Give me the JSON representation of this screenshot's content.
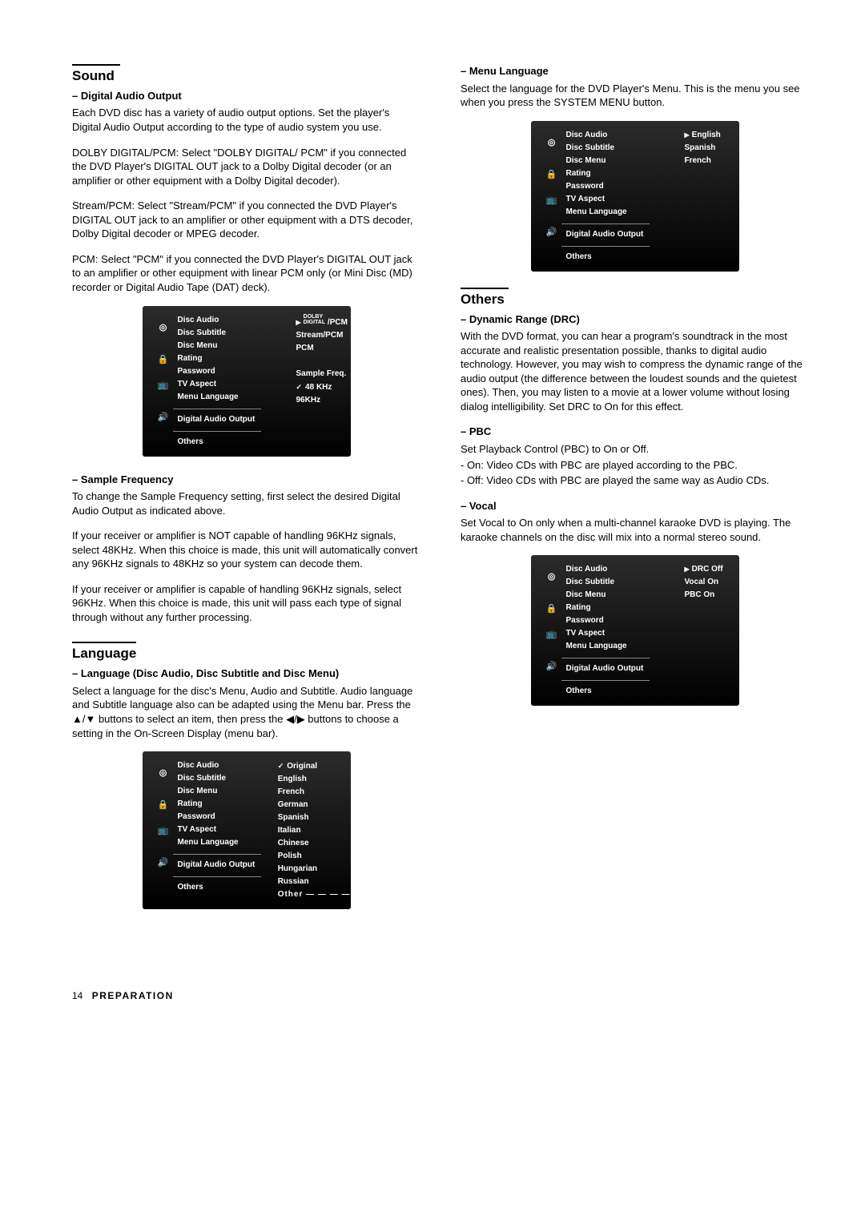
{
  "left": {
    "sound": {
      "rule": true,
      "title": "Sound",
      "sections": [
        {
          "sub": "Digital Audio Output",
          "paras": [
            "Each DVD disc has a variety of audio output options. Set the player's Digital Audio Output according to the type of audio system you use.",
            "DOLBY DIGITAL/PCM: Select \"DOLBY DIGITAL/ PCM\" if you connected the DVD Player's DIGITAL OUT jack to a Dolby Digital decoder (or an amplifier or other equipment with a Dolby Digital decoder).",
            "Stream/PCM: Select \"Stream/PCM\" if you connected the DVD Player's DIGITAL OUT jack to an amplifier or other equipment with a DTS decoder, Dolby Digital decoder or MPEG decoder.",
            "PCM: Select \"PCM\" if you connected the DVD Player's DIGITAL OUT jack to an amplifier or other equipment with linear PCM only (or Mini Disc (MD) recorder or Digital Audio Tape (DAT) deck)."
          ]
        },
        {
          "sub": "Sample Frequency",
          "paras": [
            "To change the Sample Frequency setting, first select the desired Digital Audio Output as indicated above.",
            "If your receiver or amplifier is NOT capable of handling 96KHz signals, select 48KHz. When this choice is made, this unit will automatically convert any 96KHz signals to 48KHz so your system can decode them.",
            "If your receiver or amplifier is capable of handling 96KHz signals, select 96KHz. When this choice is made, this unit will pass each type of signal through without any further processing."
          ]
        }
      ]
    },
    "language": {
      "rule": true,
      "title": "Language",
      "sections": [
        {
          "sub": "Language (Disc Audio, Disc Subtitle and Disc Menu)",
          "paras": [
            "Select a language for the disc's Menu, Audio and Subtitle. Audio language and Subtitle language also can be adapted using the Menu bar. Press the ▲/▼ buttons to select an item, then press the ◀/▶ buttons to choose a setting in the On-Screen Display (menu bar)."
          ]
        }
      ]
    }
  },
  "right": {
    "menulang": {
      "sub": "Menu Language",
      "paras": [
        "Select the language for the DVD Player's Menu. This is the menu you see when you press the SYSTEM MENU button."
      ]
    },
    "others": {
      "rule": true,
      "title": "Others",
      "sections": [
        {
          "sub": "Dynamic Range (DRC)",
          "paras": [
            "With the DVD format, you can hear a program's soundtrack in the most accurate and realistic presentation possible, thanks to digital audio technology. However, you may wish to compress the dynamic range of the audio output (the difference between the loudest sounds and the quietest ones). Then, you may listen to a movie at a lower volume without losing dialog intelligibility. Set DRC to On for this effect."
          ]
        },
        {
          "sub": "PBC",
          "paras": [
            "Set Playback Control (PBC) to On or Off.",
            "- On: Video CDs with PBC are played according to the PBC.",
            "- Off: Video CDs with PBC are played the same way as Audio CDs."
          ]
        },
        {
          "sub": "Vocal",
          "paras": [
            "Set Vocal to On only when a multi-channel karaoke DVD is playing. The karaoke channels on the disc will mix into a normal stereo sound."
          ]
        }
      ]
    }
  },
  "menus": {
    "m1": {
      "left": [
        "Disc Audio",
        "Disc Subtitle",
        "Disc Menu",
        "Rating",
        "Password",
        "TV Aspect",
        "Menu Language",
        "Digital Audio Output",
        "Others"
      ],
      "right_lines": [
        {
          "pre": "tri",
          "html": "<span class='tiny'>DOLBY<br>DIGITAL</span> /PCM"
        },
        {
          "t": "Stream/PCM"
        },
        {
          "t": "PCM"
        },
        {
          "t": ""
        },
        {
          "t": "Sample Freq."
        },
        {
          "pre": "check",
          "t": "48 KHz"
        },
        {
          "t": "96KHz"
        }
      ]
    },
    "m2": {
      "left": [
        "Disc Audio",
        "Disc Subtitle",
        "Disc Menu",
        "Rating",
        "Password",
        "TV Aspect",
        "Menu Language",
        "Digital Audio Output",
        "Others"
      ],
      "right_lines": [
        {
          "pre": "check",
          "t": "Original"
        },
        {
          "t": "English"
        },
        {
          "t": "French"
        },
        {
          "t": "German"
        },
        {
          "t": "Spanish"
        },
        {
          "t": "Italian"
        },
        {
          "t": "Chinese"
        },
        {
          "t": "Polish"
        },
        {
          "t": "Hungarian"
        },
        {
          "t": "Russian"
        },
        {
          "t": "Other  — — — —"
        }
      ]
    },
    "m3": {
      "left": [
        "Disc Audio",
        "Disc Subtitle",
        "Disc Menu",
        "Rating",
        "Password",
        "TV Aspect",
        "Menu Language",
        "Digital Audio Output",
        "Others"
      ],
      "right_lines": [
        {
          "pre": "tri",
          "t": "English"
        },
        {
          "t": "Spanish"
        },
        {
          "t": "French"
        }
      ]
    },
    "m4": {
      "left": [
        "Disc Audio",
        "Disc Subtitle",
        "Disc Menu",
        "Rating",
        "Password",
        "TV Aspect",
        "Menu Language",
        "Digital Audio Output",
        "Others"
      ],
      "right_lines": [
        {
          "pre": "tri",
          "t": "DRC   Off"
        },
        {
          "t": "Vocal  On"
        },
        {
          "t": "PBC    On"
        }
      ]
    }
  },
  "footer": {
    "page": "14",
    "label": "PREPARATION"
  }
}
